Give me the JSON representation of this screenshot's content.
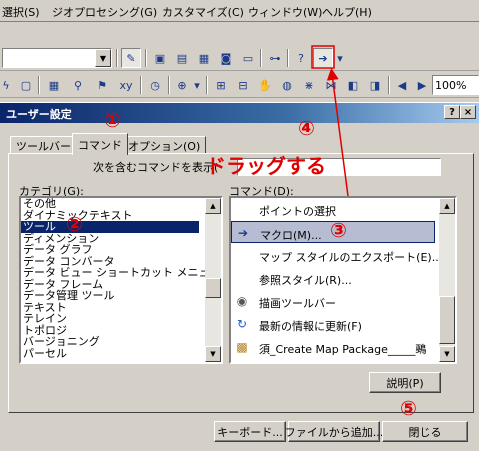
{
  "menu": {
    "items": [
      "選択(S)",
      "ジオプロセシング(G)",
      "カスタマイズ(C)",
      "ウィンドウ(W)",
      "ヘルプ(H)"
    ]
  },
  "toolbar2": {
    "zoom_value": "100%"
  },
  "dialog": {
    "title": "ユーザー設定",
    "help_btn": "?",
    "close_btn": "×",
    "tabs": [
      "ツールバー",
      "コマンド",
      "オプション(O)"
    ],
    "search_label": "次を含むコマンドを表示(",
    "search_value": "",
    "category_label": "カテゴリ(G):",
    "command_label": "コマンド(D):",
    "categories": [
      "その他",
      "ダイナミックテキスト",
      "ツール",
      "ディメンション",
      "データ グラフ",
      "データ コンバータ",
      "データ ビュー ショートカット メニュー",
      "データ フレーム",
      "データ管理 ツール",
      "テキスト",
      "テレイン",
      "トポロジ",
      "バージョニング",
      "パーセル"
    ],
    "selected_category": 2,
    "commands": [
      {
        "label": "ポイントの選択",
        "icon": "none"
      },
      {
        "label": "マクロ(M)...",
        "icon": "macro-icon"
      },
      {
        "label": "マップ スタイルのエクスポート(E)...",
        "icon": "none"
      },
      {
        "label": "参照スタイル(R)...",
        "icon": "none"
      },
      {
        "label": "描画ツールバー",
        "icon": "draw-toolbar-icon"
      },
      {
        "label": "最新の情報に更新(F)",
        "icon": "refresh-icon"
      },
      {
        "label": "須_Create Map Package_____鵐",
        "icon": "package-icon"
      }
    ],
    "selected_command": 1,
    "describe_btn": "説明(P)",
    "keyboard_btn": "キーボード...",
    "add_from_file_btn": "ファイルから追加...",
    "close_dialog_btn": "閉じる"
  },
  "annotations": {
    "n1": "①",
    "n2": "②",
    "n3": "③",
    "n4": "④",
    "n5": "⑤",
    "drag_text": "ドラッグする",
    "color": "#e00000"
  },
  "colors": {
    "title_bar": "#0a246a",
    "selection": "#0a246a",
    "window_bg": "#d4d0c8"
  }
}
